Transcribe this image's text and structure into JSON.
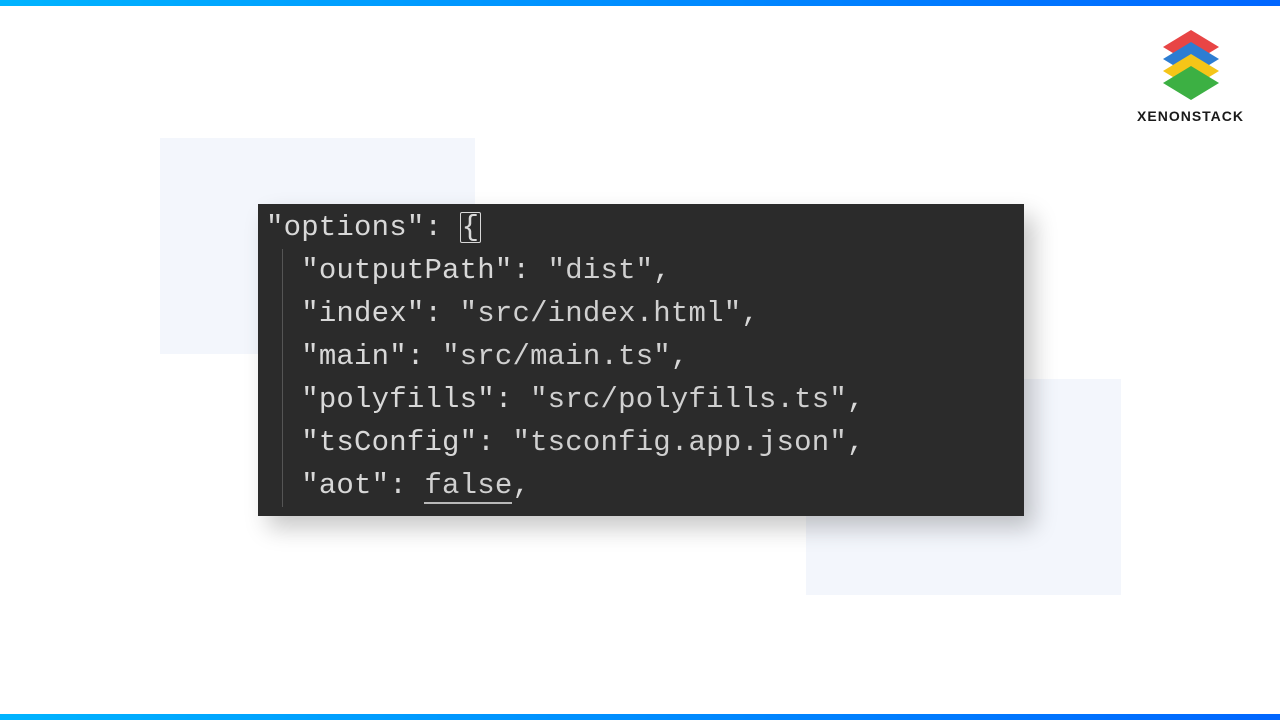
{
  "logo": {
    "text": "XENONSTACK"
  },
  "code": {
    "key_options": "\"options\"",
    "brace_open": "{",
    "line_outputPath_key": "\"outputPath\"",
    "line_outputPath_val": "\"dist\"",
    "line_index_key": "\"index\"",
    "line_index_val": "\"src/index.html\"",
    "line_main_key": "\"main\"",
    "line_main_val": "\"src/main.ts\"",
    "line_polyfills_key": "\"polyfills\"",
    "line_polyfills_val": "\"src/polyfills.ts\"",
    "line_tsConfig_key": "\"tsConfig\"",
    "line_tsConfig_val": "\"tsconfig.app.json\"",
    "line_aot_key": "\"aot\"",
    "line_aot_val": "false",
    "colon": ": ",
    "comma": ","
  },
  "colors": {
    "editor_bg": "#2b2b2b",
    "accent_bg": "#f3f6fc"
  }
}
